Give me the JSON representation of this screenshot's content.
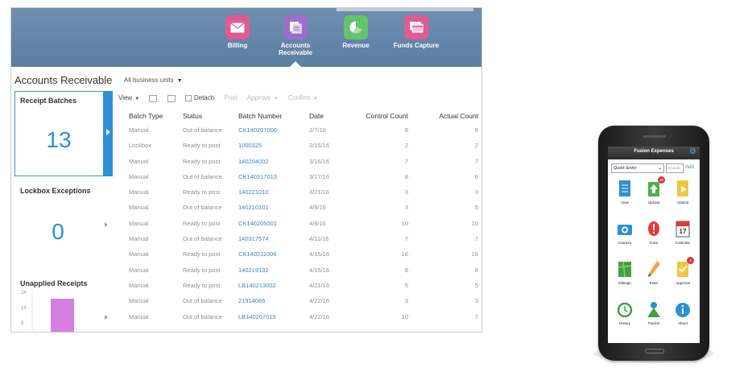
{
  "nav": {
    "items": [
      {
        "label": "Billing",
        "icon": "envelope-icon",
        "color": "#e05b92"
      },
      {
        "label": "Accounts\nReceivable",
        "icon": "receipts-icon",
        "color": "#9b6fc9"
      },
      {
        "label": "Revenue",
        "icon": "pie-chart-icon",
        "color": "#63c46b"
      },
      {
        "label": "Funds Capture",
        "icon": "cards-icon",
        "color": "#e05b92"
      }
    ]
  },
  "page": {
    "title": "Accounts Receivable",
    "business_unit": "All business units"
  },
  "receipt_batches": {
    "title": "Receipt Batches",
    "count": "13"
  },
  "lockbox": {
    "title": "Lockbox Exceptions",
    "count": "0"
  },
  "unapplied": {
    "title": "Unapplied Receipts",
    "ticks": [
      "24",
      "16",
      "8"
    ],
    "bar_value": 16,
    "bar_color": "#d77fe0"
  },
  "toolbar": {
    "view": "View",
    "detach": "Detach",
    "post": "Post",
    "approve": "Approve",
    "confirm": "Confirm"
  },
  "table": {
    "headers": [
      "Batch Type",
      "Status",
      "Batch Number",
      "Date",
      "Control Count",
      "Actual Count"
    ],
    "rows": [
      [
        "Manual",
        "Out of balance",
        "CK140207006",
        "2/7/16",
        "8",
        "9"
      ],
      [
        "Lockbox",
        "Ready to post",
        "1000325",
        "2/15/16",
        "2",
        "2"
      ],
      [
        "Manual",
        "Ready to post",
        "140204002",
        "3/16/16",
        "7",
        "7"
      ],
      [
        "Manual",
        "Out of balance",
        "CK140317013",
        "3/17/16",
        "8",
        "6"
      ],
      [
        "Manual",
        "Ready to post",
        "140221010",
        "3/21/16",
        "3",
        "3"
      ],
      [
        "Manual",
        "Out of balance",
        "140210101",
        "4/8/16",
        "3",
        "5"
      ],
      [
        "Manual",
        "Ready to post",
        "CK140205001",
        "4/8/16",
        "10",
        "10"
      ],
      [
        "Manual",
        "Out of balance",
        "140317574",
        "4/11/16",
        "7",
        "7"
      ],
      [
        "Manual",
        "Ready to post",
        "CK140211006",
        "4/15/16",
        "16",
        "16"
      ],
      [
        "Manual",
        "Ready to post",
        "140219132",
        "4/15/16",
        "8",
        "8"
      ],
      [
        "Manual",
        "Ready to post",
        "LB140213002",
        "4/21/16",
        "5",
        "5"
      ],
      [
        "Manual",
        "Out of balance",
        "21914085",
        "4/22/16",
        "3",
        "3"
      ],
      [
        "Manual",
        "Out of balance",
        "LB140207015",
        "4/22/16",
        "10",
        "7"
      ]
    ]
  },
  "phone": {
    "title": "Fusion Expenses",
    "entry_select": "Quick Entry",
    "amount_placeholder": "Amount",
    "add": "Add",
    "tiles": [
      {
        "label": "View",
        "icon": "document-icon",
        "color": "#2e8fd8",
        "badge": ""
      },
      {
        "label": "Upload",
        "icon": "upload-icon",
        "color": "#4caf50",
        "badge": "10"
      },
      {
        "label": "Submit",
        "icon": "submit-icon",
        "color": "#f4c542",
        "badge": ""
      },
      {
        "label": "Camera",
        "icon": "camera-icon",
        "color": "#2e8fd8",
        "badge": ""
      },
      {
        "label": "Voice",
        "icon": "microphone-icon",
        "color": "#e53935",
        "badge": ""
      },
      {
        "label": "Calendar",
        "icon": "calendar-icon",
        "color": "#e53935",
        "badge": ""
      },
      {
        "label": "Mileage",
        "icon": "map-icon",
        "color": "#43a047",
        "badge": ""
      },
      {
        "label": "Enter",
        "icon": "pencil-icon",
        "color": "#f4a742",
        "badge": ""
      },
      {
        "label": "Approval",
        "icon": "checklist-icon",
        "color": "#f4c542",
        "badge": "4"
      },
      {
        "label": "History",
        "icon": "history-icon",
        "color": "#43a047",
        "badge": ""
      },
      {
        "label": "Tracker",
        "icon": "tracker-icon",
        "color": "#43a047",
        "badge": ""
      },
      {
        "label": "About",
        "icon": "info-icon",
        "color": "#2e8fd8",
        "badge": ""
      }
    ],
    "calendar_day": "17"
  }
}
